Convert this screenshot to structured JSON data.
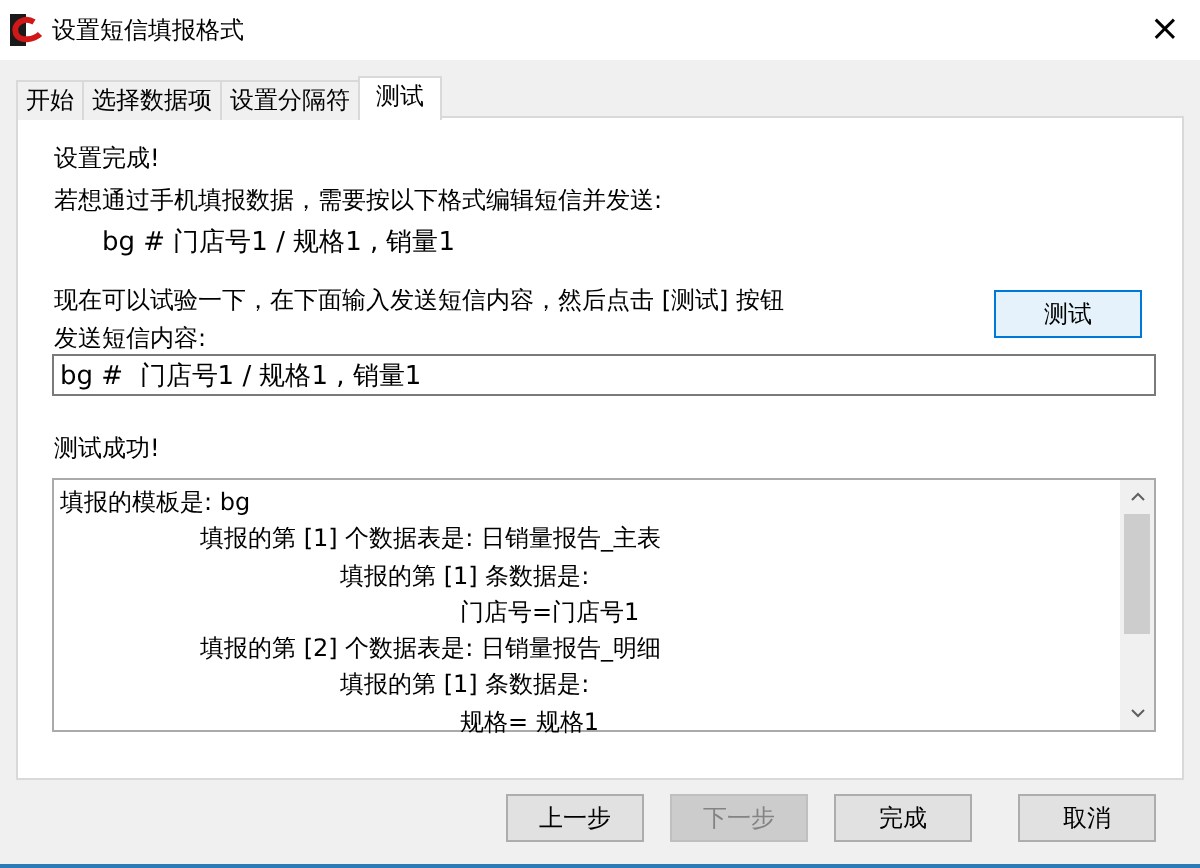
{
  "window": {
    "title": "设置短信填报格式",
    "close": "×"
  },
  "tabs": [
    {
      "label": "开始",
      "selected": false
    },
    {
      "label": "选择数据项",
      "selected": false
    },
    {
      "label": "设置分隔符",
      "selected": false
    },
    {
      "label": "测试",
      "selected": true
    }
  ],
  "panel": {
    "done_text": "设置完成!",
    "instruction": "若想通过手机填报数据，需要按以下格式编辑短信并发送:",
    "format": "bg #  门店号1 / 规格1 , 销量1",
    "hint": "现在可以试验一下，在下面输入发送短信内容，然后点击 [测试] 按钮",
    "test_button": "测试",
    "input_label": "发送短信内容:",
    "input_value": "bg #  门店号1 / 规格1 , 销量1",
    "result_label": "测试成功!",
    "result_lines": [
      {
        "text": "填报的模板是: bg",
        "children": [
          {
            "text": "填报的第 [1] 个数据表是: 日销量报告_主表",
            "children": [
              {
                "text": "填报的第 [1] 条数据是:",
                "children": [
                  {
                    "text": "门店号=门店号1"
                  }
                ]
              }
            ]
          },
          {
            "text": "填报的第 [2] 个数据表是: 日销量报告_明细",
            "children": [
              {
                "text": "填报的第 [1] 条数据是:",
                "children": [
                  {
                    "text": "规格= 规格1"
                  }
                ]
              }
            ]
          }
        ]
      }
    ]
  },
  "buttons": [
    {
      "label": "上一步",
      "disabled": false
    },
    {
      "label": "下一步",
      "disabled": true
    },
    {
      "label": "完成",
      "disabled": false
    },
    {
      "label": "取消",
      "disabled": false
    }
  ]
}
